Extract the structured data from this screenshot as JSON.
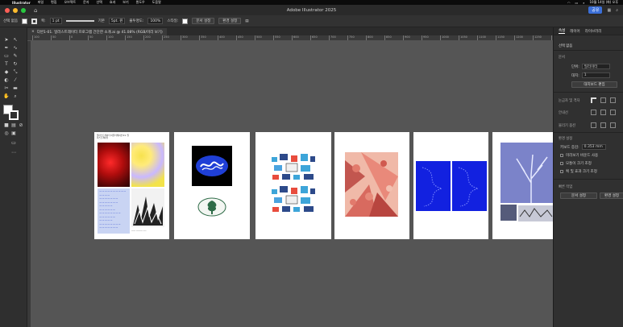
{
  "menubar": {
    "app_name": "Illustrator",
    "items": [
      "파일",
      "편집",
      "오브젝트",
      "문자",
      "선택",
      "효과",
      "보기",
      "윈도우",
      "도움말"
    ],
    "clock": "10월 14일 (화) 오후"
  },
  "window": {
    "title": "Adobe Illustrator 2025",
    "share_label": "공유"
  },
  "controlbar": {
    "selection_label": "선택 없음",
    "stroke_label": "획:",
    "stroke_value": "1 pt",
    "brush_label": "기본",
    "brush_value": "5pt. 원",
    "opacity_label": "불투명도:",
    "opacity_value": "100%",
    "style_label": "스타일:",
    "doc_setup": "문서 설정",
    "prefs": "환경 설정"
  },
  "document_tab": {
    "title": "다반1-01. 일러스트레이터 프로그램 간단한 소개.ai @ 41.08% (RGB/미리 보기)"
  },
  "ruler": {
    "labels": [
      "100",
      "50",
      "0",
      "50",
      "100",
      "150",
      "200",
      "250",
      "300",
      "350",
      "400",
      "450",
      "500",
      "550",
      "600",
      "650",
      "700",
      "750",
      "800",
      "850",
      "900",
      "950",
      "1000",
      "1050",
      "1100",
      "1150",
      "1200",
      "1250",
      "1300"
    ]
  },
  "artboards": [
    {
      "name": "artboard-1",
      "heading": "일러스트레이터 어플리케이션 01. 일러스트레이터",
      "footer": "____ ______ ___"
    },
    {
      "name": "artboard-2"
    },
    {
      "name": "artboard-3"
    },
    {
      "name": "artboard-4"
    },
    {
      "name": "artboard-5"
    },
    {
      "name": "artboard-6"
    }
  ],
  "panel": {
    "tabs": [
      "속성",
      "레이어",
      "라이브러리"
    ],
    "no_selection": "선택 없음",
    "document_section": "문서",
    "unit_label": "단위:",
    "unit_value": "밀리미터",
    "artboard_label": "대지:",
    "artboard_value": "1",
    "edit_artboard": "대지보드 편집",
    "ruler_grid": "눈금자 및 격자",
    "guides": "안내선",
    "snap_options": "물리기 옵션",
    "prefs_section": "환경 설정",
    "keyboard_inc_label": "키보드 증감:",
    "keyboard_inc_value": "0.353 mm",
    "option_preview_bounds": "미리보기 바운드 사용",
    "option_scale_corners": "모퉁이 크기 조정",
    "option_scale_strokes": "획 및 효과 크기 조정",
    "quick_actions": "빠른 작업",
    "doc_setup_btn": "문서 설정",
    "prefs_btn": "환경 설정"
  },
  "colors": {
    "accent": "#3b6fd8",
    "canvas": "#555555",
    "artboard": "#ffffff",
    "traffic_close": "#ff5f57",
    "traffic_min": "#febc2e",
    "traffic_max": "#28c840"
  }
}
